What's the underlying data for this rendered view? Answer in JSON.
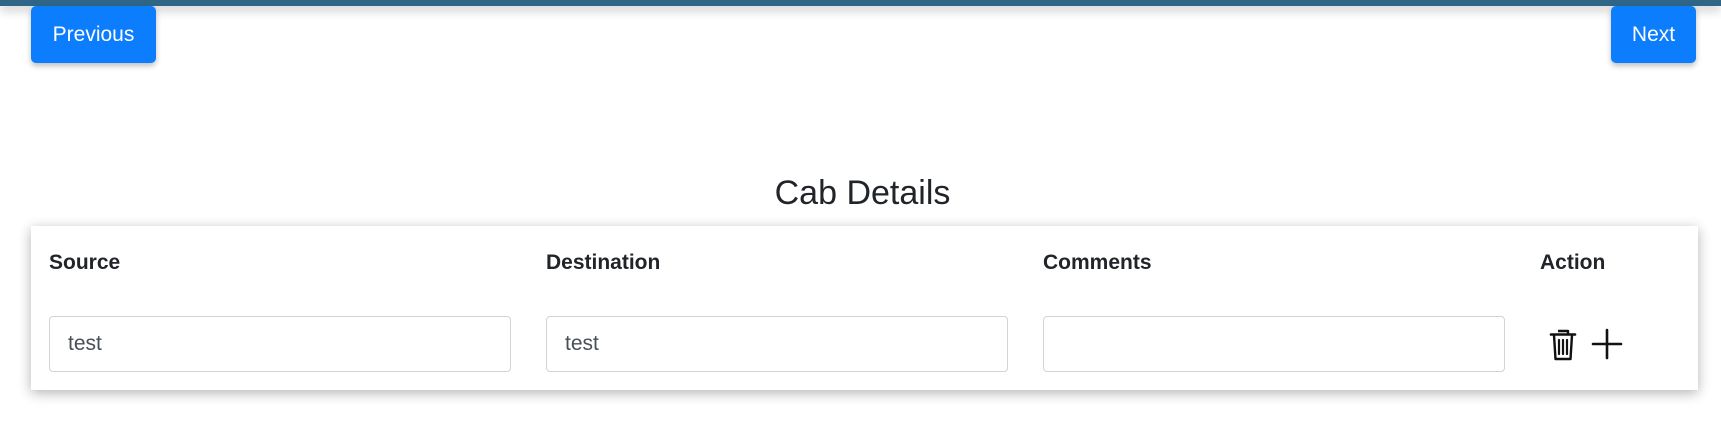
{
  "navigation": {
    "previous_label": "Previous",
    "next_label": "Next"
  },
  "section": {
    "title": "Cab Details"
  },
  "table": {
    "headers": {
      "source": "Source",
      "destination": "Destination",
      "comments": "Comments",
      "action": "Action"
    },
    "row": {
      "source": "test",
      "destination": "test",
      "comments": ""
    },
    "actions": {
      "delete_icon": "trash-icon",
      "add_icon": "plus-icon"
    }
  },
  "colors": {
    "top_bar": "#2f6586",
    "primary_button": "#0b7dfd"
  }
}
